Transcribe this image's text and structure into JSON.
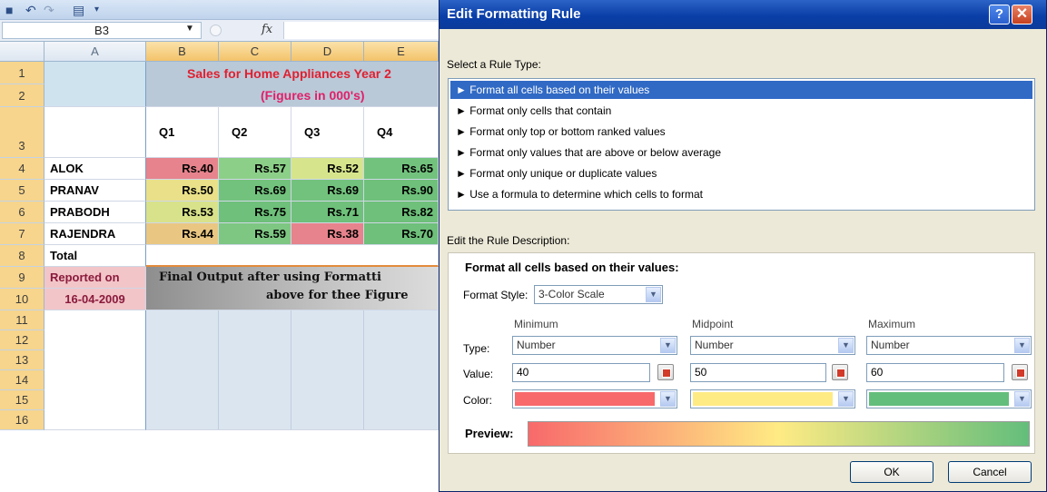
{
  "excel": {
    "name_box": "B3",
    "fx_label": "fx",
    "columns": [
      "A",
      "B",
      "C",
      "D",
      "E"
    ],
    "row_numbers": [
      "1",
      "2",
      "3",
      "4",
      "5",
      "6",
      "7",
      "8",
      "9",
      "10",
      "11",
      "12",
      "13",
      "14",
      "15",
      "16"
    ],
    "title_line1": "Sales for Home Appliances Year 2",
    "title_line2": "(Figures in 000's)",
    "title_color": "#e02030",
    "quarters": [
      "Q1",
      "Q2",
      "Q3",
      "Q4"
    ],
    "rows": [
      {
        "name": "ALOK",
        "values": [
          "Rs.40",
          "Rs.57",
          "Rs.52",
          "Rs.65"
        ],
        "colors": [
          "#e6838c",
          "#8ccf88",
          "#d6e58c",
          "#72c27d"
        ]
      },
      {
        "name": "PRANAV",
        "values": [
          "Rs.50",
          "Rs.69",
          "Rs.69",
          "Rs.90"
        ],
        "colors": [
          "#e9e089",
          "#72c27d",
          "#72c27d",
          "#6ec07a"
        ]
      },
      {
        "name": "PRABODH",
        "values": [
          "Rs.53",
          "Rs.75",
          "Rs.71",
          "Rs.82"
        ],
        "colors": [
          "#d8e28a",
          "#6ec07a",
          "#6ec07a",
          "#6ec07a"
        ]
      },
      {
        "name": "RAJENDRA",
        "values": [
          "Rs.44",
          "Rs.59",
          "Rs.38",
          "Rs.70"
        ],
        "colors": [
          "#e9c783",
          "#7ec783",
          "#e6838c",
          "#6ec07a"
        ]
      }
    ],
    "total_label": "Total",
    "reported_label": "Reported on",
    "reported_date": "16-04-2009",
    "final_output_line1": "Final Output after using Formatti",
    "final_output_line2": "above for thee Figure"
  },
  "dialog": {
    "title": "Edit Formatting Rule",
    "help_glyph": "?",
    "close_glyph": "✕",
    "select_rule_label": "Select a Rule Type:",
    "rule_types": [
      "► Format all cells based on their values",
      "► Format only cells that contain",
      "► Format only top or bottom ranked values",
      "► Format only values that are above or below average",
      "► Format only unique or duplicate values",
      "► Use a formula to determine which cells to format"
    ],
    "selected_rule_index": 0,
    "edit_desc_label": "Edit the Rule Description:",
    "desc_heading": "Format all cells based on their values:",
    "format_style_label": "Format Style:",
    "format_style_value": "3-Color Scale",
    "minimum_label": "Minimum",
    "midpoint_label": "Midpoint",
    "maximum_label": "Maximum",
    "type_label": "Type:",
    "value_label": "Value:",
    "color_label": "Color:",
    "min_type": "Number",
    "mid_type": "Number",
    "max_type": "Number",
    "min_value": "40",
    "mid_value": "50",
    "max_value": "60",
    "min_color": "#f8696b",
    "mid_color": "#ffeb84",
    "max_color": "#63be7b",
    "preview_label": "Preview:",
    "ok_label": "OK",
    "cancel_label": "Cancel"
  }
}
